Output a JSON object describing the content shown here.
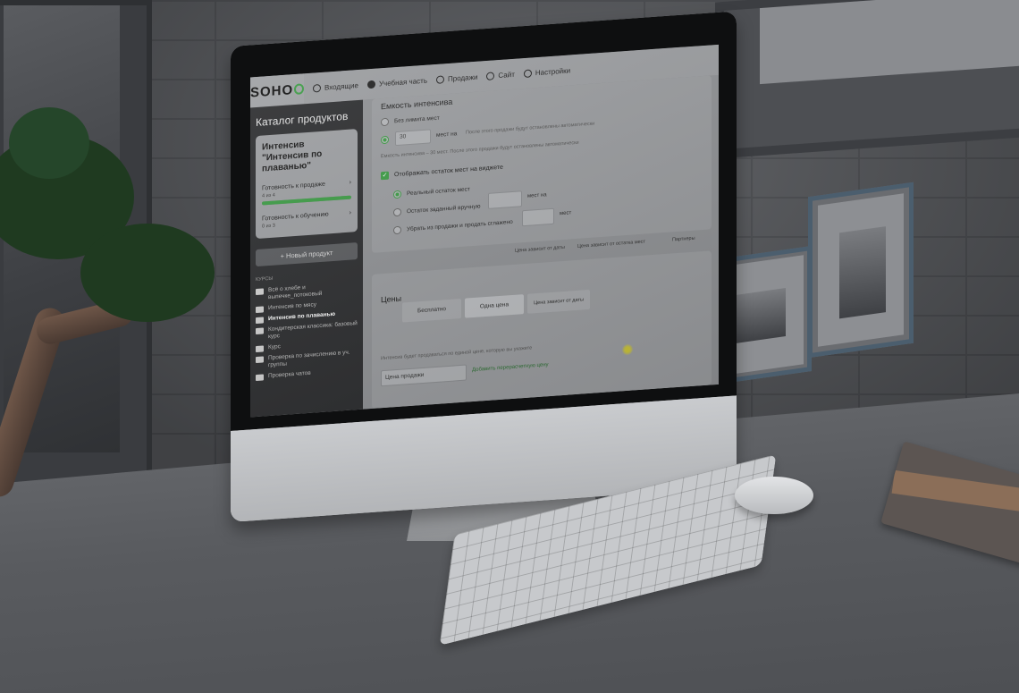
{
  "app": {
    "logo": "SOHO",
    "nav": [
      {
        "label": "Входящие",
        "active": false
      },
      {
        "label": "Учебная часть",
        "active": true
      },
      {
        "label": "Продажи",
        "active": false
      },
      {
        "label": "Сайт",
        "active": false
      },
      {
        "label": "Настройки",
        "active": false
      }
    ]
  },
  "sidebar": {
    "title": "Каталог продуктов",
    "card": {
      "title": "Интенсив \"Интенсив по плаванью\"",
      "sales_ready_label": "Готовность к продаже",
      "sales_ready_count": "4 из 4",
      "sales_ready_progress": 1.0,
      "edu_ready_label": "Готовность к обучению",
      "edu_ready_count": "0 из 3"
    },
    "new_product": "Новый продукт",
    "section_label": "КУРСЫ",
    "courses": [
      {
        "label": "Всё о хлебе и выпечке_потоковый",
        "active": false
      },
      {
        "label": "Интенсив по мясу",
        "active": false
      },
      {
        "label": "Интенсив по плаванью",
        "active": true
      },
      {
        "label": "Кондитерская классика: базовый курс",
        "active": false
      },
      {
        "label": "Курс",
        "active": false
      },
      {
        "label": "Проверка по зачислению в уч. группы",
        "active": false
      },
      {
        "label": "Проверка чатов",
        "active": false
      }
    ]
  },
  "capacity": {
    "title": "Емкость интенсива",
    "no_limit": "Без лимита мест",
    "seats_value": "30",
    "seats_suffix": "мест на",
    "seats_hint": "После этого продажи будут остановлены автоматически",
    "capacity_note": "Емкость интенсива – 30 мест. После этого продажи будут остановлены автоматически",
    "show_remaining": "Отображать остаток мест на виджете",
    "real_remaining": "Реальный остаток мест",
    "manual_remaining": "Остаток заданный вручную",
    "manual_suffix": "мест на",
    "hide_after": "Убрать из продажи и продать сглажено",
    "hide_suffix": "мест",
    "tabs": [
      "Цена зависит от даты",
      "Цена зависит от остатка мест",
      "Партнеры"
    ]
  },
  "prices": {
    "title": "Цены",
    "options": [
      "Бесплатно",
      "Одна цена",
      "Цена зависит от даты"
    ],
    "active_option": "Одна цена",
    "hint": "Интенсив будет продаваться по единой цене, которую вы укажете",
    "price_label": "Цена продажи",
    "add_link": "Добавить перерасчетную цену"
  }
}
